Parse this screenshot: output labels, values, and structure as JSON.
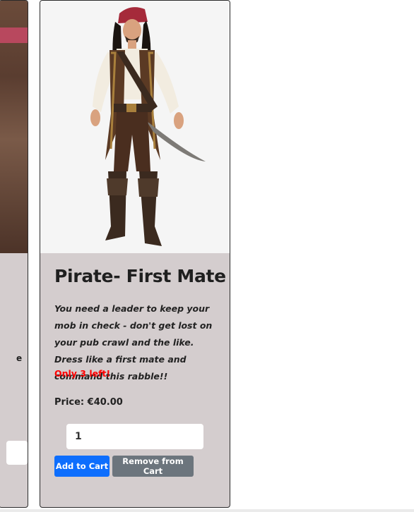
{
  "left_card": {
    "description_fragment": "e"
  },
  "product": {
    "title": "Pirate- First Mate",
    "description": "You need a leader to keep your mob in check - don't get lost on your pub crawl and the like. Dress like a first mate and command this rabble!!",
    "stock_warning": "Only 3 left!",
    "price": "Price: €40.00",
    "quantity": "1",
    "add_label": "Add to Cart",
    "remove_label": "Remove from Cart"
  },
  "colors": {
    "card_bg": "#d4cdce",
    "add_button": "#0d6efd",
    "remove_button": "#6c757d",
    "stock_warning": "#ff0000"
  }
}
